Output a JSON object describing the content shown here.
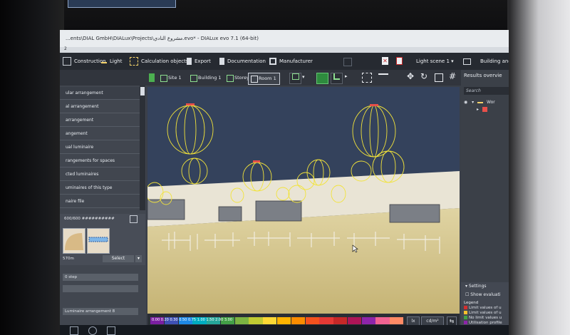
{
  "window": {
    "title": "...ents\\DIAL GmbH\\DIALux\\Projects\\مشروع النادي.evo* - DIALux evo 7.1 (64-bit)",
    "sub_mark": "2"
  },
  "menubar": {
    "items": [
      {
        "label": "Construction",
        "icon": "construction-icon"
      },
      {
        "label": "Light",
        "icon": "light-icon"
      },
      {
        "label": "Calculation objects",
        "icon": "calculation-objects-icon"
      },
      {
        "label": "Export",
        "icon": "export-icon"
      },
      {
        "label": "Documentation",
        "icon": "documentation-icon"
      },
      {
        "label": "Manufacturer",
        "icon": "manufacturer-icon"
      }
    ],
    "light_scene": "Light scene 1",
    "building_label": "Building and"
  },
  "view_tabs": [
    {
      "label": "Site 1"
    },
    {
      "label": "Building 1"
    },
    {
      "label": "Storey 1"
    },
    {
      "label": "Room 1"
    }
  ],
  "left_panel": {
    "items": [
      "ular arrangement",
      "al arrangement",
      "arrangement",
      "angement",
      "ual luminaire",
      "rangements for spaces",
      "cted luminaires",
      "uminaires of this type",
      "naire file"
    ],
    "product_label": "600/600 ##########",
    "product_size": "570m",
    "select_label": "Select",
    "fields": [
      "0 step",
      "",
      "Luminaire arrangement 8"
    ]
  },
  "legend": {
    "values": [
      "0.00",
      "0.20",
      "0.30",
      "0.50",
      "0.75",
      "1.00",
      "1.50",
      "2.00",
      "3.00"
    ],
    "colors": [
      "#7b1fa2",
      "#3f51b5",
      "#1e88e5",
      "#00acc1",
      "#26a69a",
      "#43a047",
      "#7cb342",
      "#c0ca33",
      "#fdd835",
      "#ffb300",
      "#fb8c00",
      "#f4511e",
      "#e53935",
      "#c62828",
      "#ad1457",
      "#8e24aa",
      "#f06292",
      "#ff8a65"
    ],
    "unit_lx": "lx",
    "unit_cd": "cd/m²"
  },
  "results_panel": {
    "title": "Results overvie",
    "search_placeholder": "Search",
    "tree_root": "Wor",
    "settings_title": "Settings",
    "show_evaluation": "Show evaluati",
    "legend_title": "Legend",
    "legend_items": [
      {
        "label": "Limit values of u",
        "color": "#d32f2f"
      },
      {
        "label": "Limit values of u",
        "color": "#fbc02d"
      },
      {
        "label": "No limit values u",
        "color": "#43a047"
      },
      {
        "label": "Utilisation profile",
        "color": "#8e24aa"
      }
    ]
  }
}
